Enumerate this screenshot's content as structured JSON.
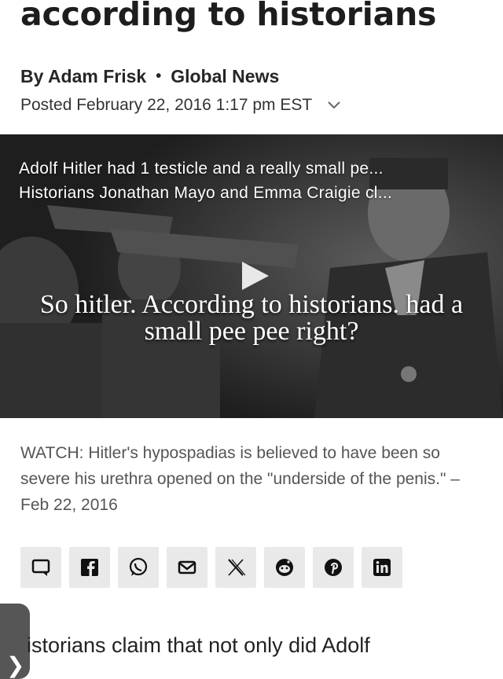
{
  "article": {
    "headline": "according to historians",
    "author": "By Adam Frisk",
    "separator": "•",
    "source": "Global News",
    "posted": "Posted February 22, 2016 1:17 pm EST"
  },
  "video": {
    "title_line1": "Adolf Hitler had 1 testicle and a really small pe...",
    "title_line2": "Historians Jonathan Mayo and Emma Craigie cl...",
    "overlay_caption": "So hitler. According to historians.  had a small pee pee right?",
    "play_icon": "play-icon"
  },
  "watch_caption": "WATCH: Hitler's hypospadias is believed to have been so severe his urethra opened on the \"underside of the penis.\" – Feb 22, 2016",
  "share": {
    "icons": [
      "comment-icon",
      "facebook-icon",
      "whatsapp-icon",
      "email-icon",
      "x-icon",
      "reddit-icon",
      "pinterest-icon",
      "linkedin-icon"
    ]
  },
  "body": {
    "first_line": "istorians claim that not only did Adolf"
  },
  "side_tab": {
    "arrow": "❯"
  }
}
